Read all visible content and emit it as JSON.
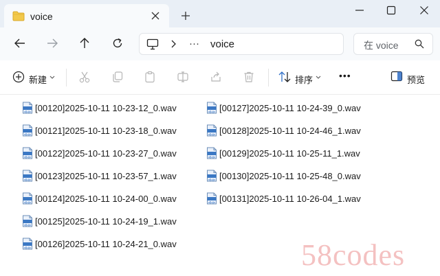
{
  "window": {
    "tab_title": "voice",
    "new_tab_glyph": "+"
  },
  "navigation": {
    "path_ellipsis": "···",
    "current_folder": "voice",
    "search_placeholder": "在 voice"
  },
  "toolbar": {
    "new_label": "新建",
    "sort_label": "排序",
    "more_glyph": "•••",
    "preview_label": "预览"
  },
  "files": {
    "col1": [
      "[00120]2025-10-11 10-23-12_0.wav",
      "[00121]2025-10-11 10-23-18_0.wav",
      "[00122]2025-10-11 10-23-27_0.wav",
      "[00123]2025-10-11 10-23-57_1.wav",
      "[00124]2025-10-11 10-24-00_0.wav",
      "[00125]2025-10-11 10-24-19_1.wav",
      "[00126]2025-10-11 10-24-21_0.wav"
    ],
    "col2": [
      "[00127]2025-10-11 10-24-39_0.wav",
      "[00128]2025-10-11 10-24-46_1.wav",
      "[00129]2025-10-11 10-25-11_1.wav",
      "[00130]2025-10-11 10-25-48_0.wav",
      "[00131]2025-10-11 10-26-04_1.wav"
    ]
  },
  "watermark": "58codes",
  "colors": {
    "titlebar_bg": "#e9eff6",
    "accent_blue": "#2f6fc7",
    "folder_yellow": "#f2c94c",
    "watermark_pink": "#f3b7b7"
  },
  "icons": [
    "folder-icon",
    "close-icon",
    "minimize-icon",
    "maximize-icon",
    "back-arrow-icon",
    "forward-arrow-icon",
    "up-arrow-icon",
    "refresh-icon",
    "computer-icon",
    "chevron-right-icon",
    "search-icon",
    "new-plus-icon",
    "cut-icon",
    "copy-icon",
    "paste-icon",
    "rename-icon",
    "share-icon",
    "delete-icon",
    "sort-icon",
    "preview-pane-icon",
    "wav-file-icon"
  ]
}
